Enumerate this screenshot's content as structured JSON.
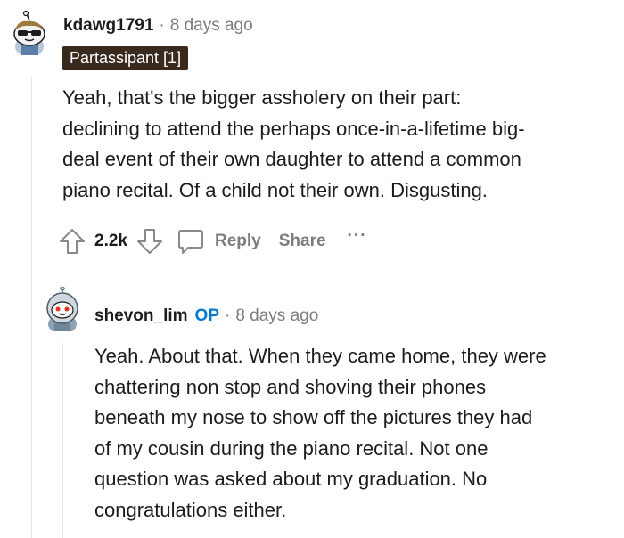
{
  "comment": {
    "username": "kdawg1791",
    "separator": "·",
    "time": "8 days ago",
    "flair": "Partassipant [1]",
    "body": [
      "Yeah, that's the bigger assholery on their part:",
      "declining to attend the perhaps once-in-a-lifetime big-",
      "deal event of their own daughter to attend a common",
      "piano recital. Of a child not their own. Disgusting."
    ],
    "votes": "2.2k",
    "reply_label": "Reply",
    "share_label": "Share",
    "more_label": "···"
  },
  "reply": {
    "username": "shevon_lim",
    "op_label": "OP",
    "separator": "·",
    "time": "8 days ago",
    "body": [
      "Yeah. About that. When they came home, they were",
      "chattering non stop and shoving their phones",
      "beneath my nose to show off the pictures they had",
      "of my cousin during the piano recital. Not one",
      "question was asked about my graduation. No",
      "congratulations either."
    ]
  },
  "colors": {
    "text": "#1c1c1c",
    "muted": "#7c7c7c",
    "op_blue": "#0079d3",
    "flair_bg": "#3a2a1e",
    "thread_line": "#e6e6e6"
  },
  "icons": {
    "upvote": "upvote-arrow-icon",
    "downvote": "downvote-arrow-icon",
    "reply": "speech-bubble-icon",
    "avatar1": "snoo-sunglasses-avatar",
    "avatar2": "snoo-astronaut-avatar"
  }
}
